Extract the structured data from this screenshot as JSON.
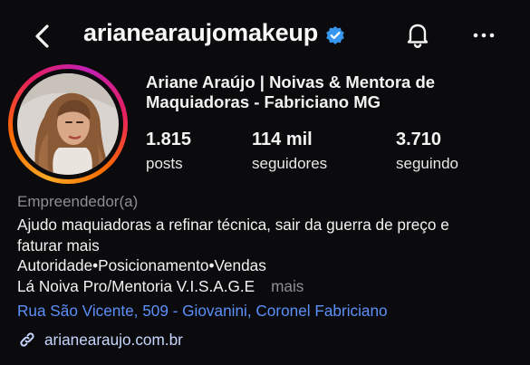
{
  "header": {
    "username": "arianearaujomakeup",
    "verified": true,
    "icons": {
      "back": "back-chevron-icon",
      "notifications": "bell-icon",
      "more": "more-dots-icon"
    }
  },
  "profile": {
    "full_name_line1": "Ariane Araújo | Noivas & Mentora de",
    "full_name_line2": "Maquiadoras - Fabriciano MG",
    "stats": [
      {
        "value": "1.815",
        "label": "posts"
      },
      {
        "value": "114 mil",
        "label": "seguidores"
      },
      {
        "value": "3.710",
        "label": "seguindo"
      }
    ],
    "category": "Empreendedor(a)",
    "bio_lines": [
      "Ajudo maquiadoras a refinar técnica, sair da guerra de preço e",
      "faturar mais",
      "Autoridade•Posicionamento•Vendas",
      "Lá Noiva Pro/Mentoria V.I.S.A.G.E"
    ],
    "more_label": "mais",
    "address": "Rua São Vicente, 509 - Giovanini, Coronel Fabriciano",
    "website": "arianearaujo.com.br"
  },
  "colors": {
    "background": "#0b0b0d",
    "link_blue": "#5b8ff9",
    "muted": "#8e8e93",
    "verified_blue": "#3797f0"
  }
}
